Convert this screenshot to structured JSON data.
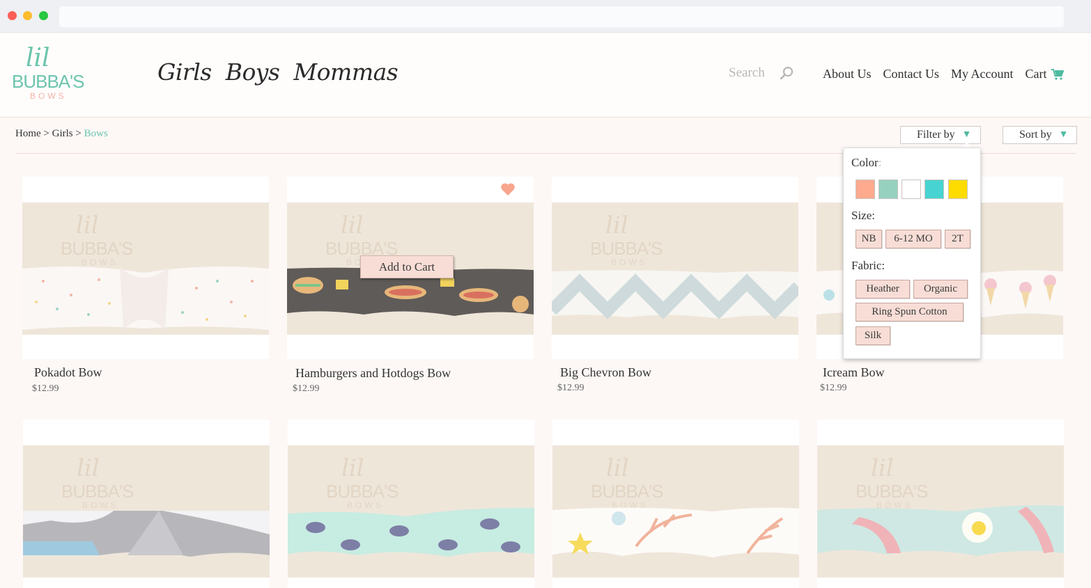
{
  "logo": {
    "lil": "lil",
    "bubbas": "BUBBA'S",
    "bows": "BOWS"
  },
  "main_nav": [
    "Girls",
    "Boys",
    "Mommas"
  ],
  "search": {
    "placeholder": "Search",
    "icon": "search-icon"
  },
  "top_nav": {
    "about": "About Us",
    "contact": "Contact Us",
    "account": "My Account",
    "cart": "Cart",
    "cart_icon": "shopping-cart-icon"
  },
  "breadcrumb": {
    "home": "Home",
    "sep": ">",
    "girls": "Girls",
    "current": "Bows"
  },
  "filter_button": {
    "label": "Filter by",
    "icon": "triangle-down-icon"
  },
  "sort_button": {
    "label": "Sort by",
    "icon": "triangle-down-icon"
  },
  "filter_panel": {
    "color_label": "Color",
    "color_colon": ":",
    "colors": [
      "#fdaa8e",
      "#96d1bf",
      "#ffffff",
      "#47d3d1",
      "#fedc00"
    ],
    "size_label": "Size:",
    "sizes": [
      "NB",
      "6-12 MO",
      "2T"
    ],
    "fabric_label": "Fabric:",
    "fabrics": [
      "Heather",
      "Organic",
      "Ring Spun Cotton",
      "Silk"
    ]
  },
  "products": [
    {
      "title": "Pokadot Bow",
      "price": "$12.99"
    },
    {
      "title": "Hamburgers and Hotdogs Bow",
      "price": "$12.99",
      "hover_action": "Add to Cart",
      "favorited": true
    },
    {
      "title": "Big Chevron Bow",
      "price": "$12.99"
    },
    {
      "title": "Icream Bow",
      "price": "$12.99"
    }
  ],
  "watermark": {
    "lil": "lil",
    "bubbas": "BUBBA'S",
    "bows": "BOWS"
  },
  "colors": {
    "accent": "#6cc4ad",
    "chip": "#f7ddd6",
    "heart": "#f8a58d"
  }
}
